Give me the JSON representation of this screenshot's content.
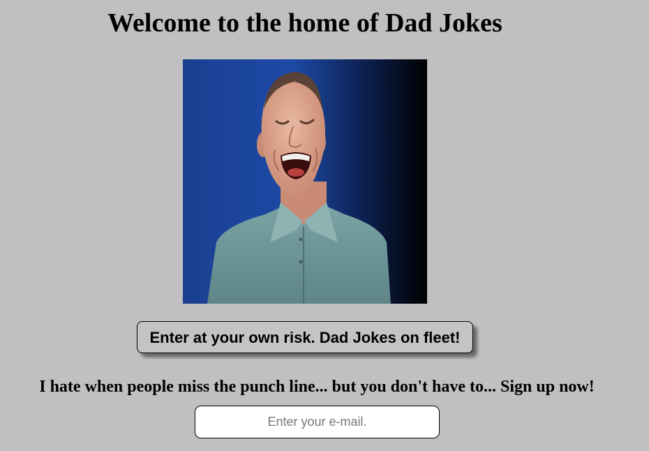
{
  "page": {
    "title": "Welcome to the home of Dad Jokes",
    "background_color": "#c0c0c0"
  },
  "hero": {
    "image_icon": "laughing-man-photo"
  },
  "cta": {
    "label": "Enter at your own risk. Dad Jokes on fleet!"
  },
  "signup": {
    "text": "I hate when people miss the punch line... but you don't have to... Sign up now!",
    "email_placeholder": "Enter your e-mail."
  }
}
